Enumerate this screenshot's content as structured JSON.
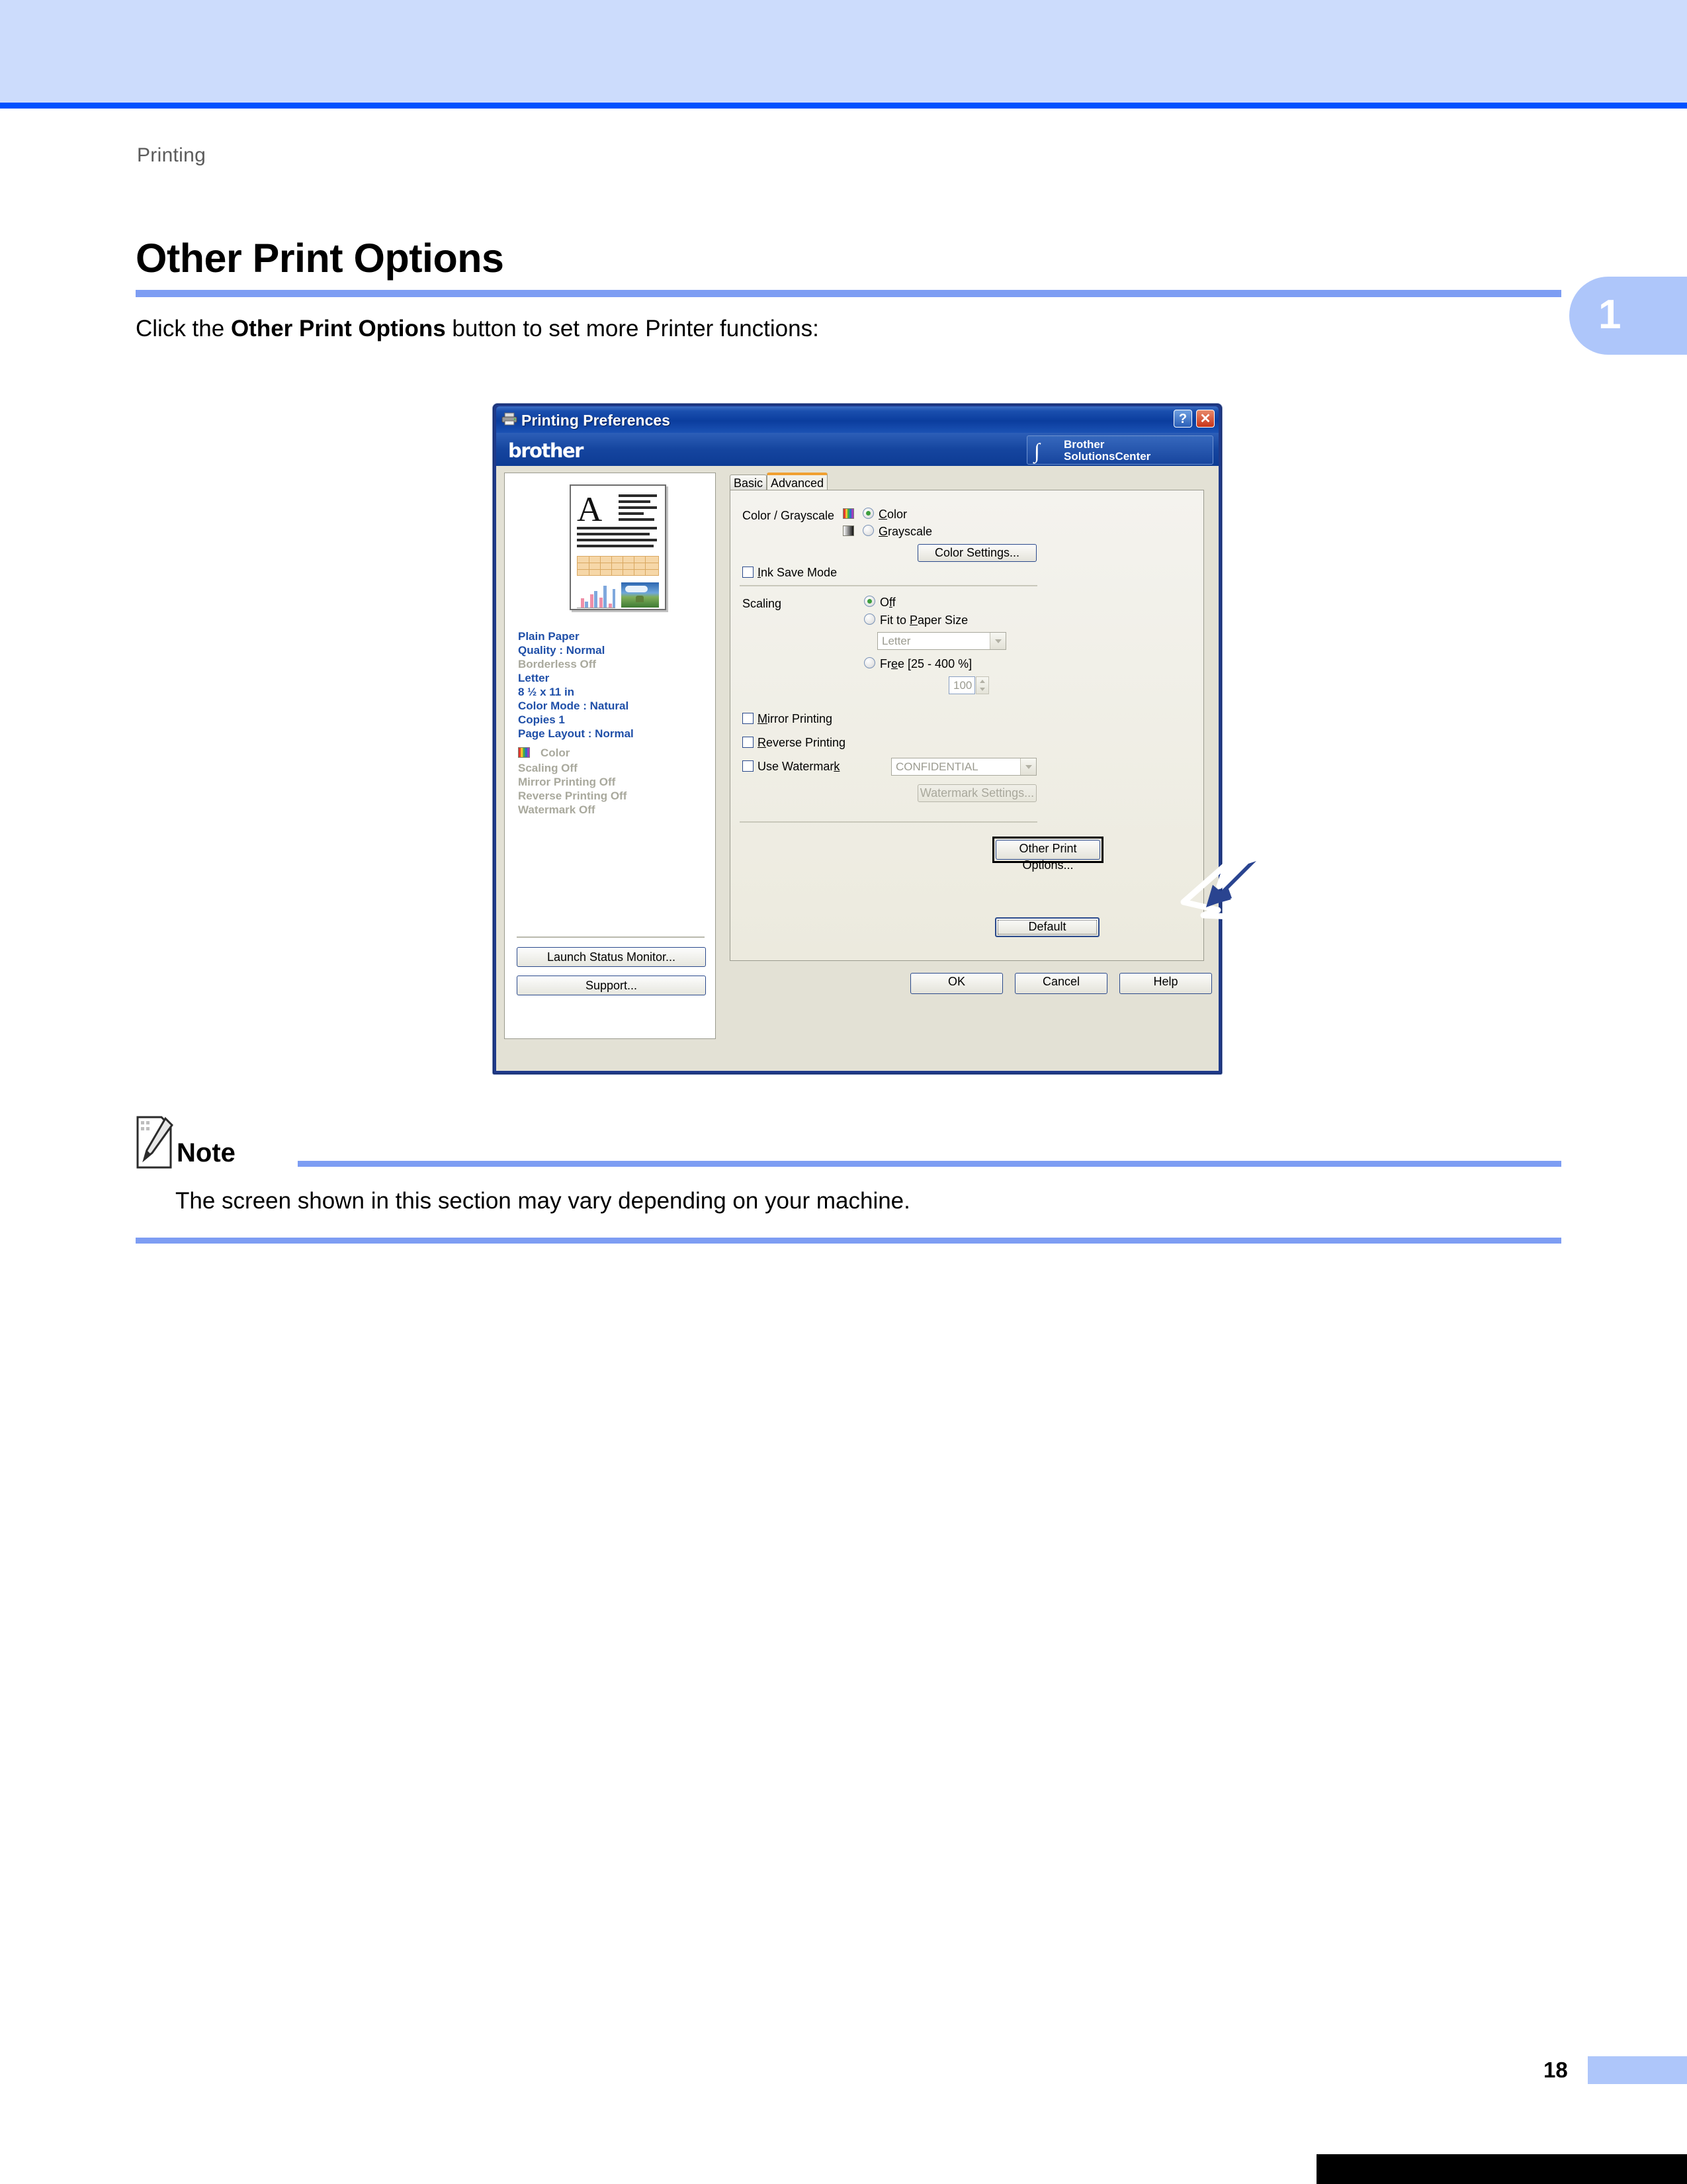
{
  "page": {
    "running_head": "Printing",
    "chapter_number": "1",
    "page_number": "18"
  },
  "heading": {
    "title": "Other Print Options"
  },
  "intro": {
    "before": "Click the ",
    "bold": "Other Print Options",
    "after": " button to set more Printer functions:"
  },
  "note": {
    "label": "Note",
    "text": "The screen shown in this section may vary depending on your machine."
  },
  "dialog": {
    "title": "Printing Preferences",
    "help_button": "?",
    "close_button": "✕",
    "brand": "brother",
    "solutions_center": {
      "line1": "Brother",
      "line2": "SolutionsCenter",
      "swoosh": "∫"
    },
    "tabs": [
      {
        "label": "Basic",
        "selected": false
      },
      {
        "label": "Advanced",
        "selected": true
      }
    ],
    "preview": {
      "settings": [
        {
          "text": "Plain Paper",
          "state": "active"
        },
        {
          "text": "Quality : Normal",
          "state": "active"
        },
        {
          "text": "Borderless Off",
          "state": "dimmed"
        },
        {
          "text": "Letter",
          "state": "active"
        },
        {
          "text": "8 ½ x 11 in",
          "state": "active"
        },
        {
          "text": "Color Mode : Natural",
          "state": "active"
        },
        {
          "text": "Copies 1",
          "state": "active"
        },
        {
          "text": "Page Layout : Normal",
          "state": "active"
        }
      ],
      "color_line": "Color",
      "status": [
        {
          "text": "Scaling Off",
          "state": "dimmed"
        },
        {
          "text": "Mirror Printing Off",
          "state": "dimmed"
        },
        {
          "text": "Reverse Printing Off",
          "state": "dimmed"
        },
        {
          "text": "Watermark Off",
          "state": "dimmed"
        }
      ],
      "buttons": [
        {
          "label": "Launch Status Monitor..."
        },
        {
          "label": "Support..."
        }
      ]
    },
    "options": {
      "color_grayscale": {
        "label": "Color / Grayscale",
        "color_option": "Color",
        "grayscale_option": "Grayscale",
        "selected": "Color",
        "color_settings_button": "Color Settings..."
      },
      "ink_save_mode": {
        "label": "Ink Save Mode",
        "checked": false
      },
      "scaling": {
        "label": "Scaling",
        "off_option": "Off",
        "fit_option": "Fit to Paper Size",
        "free_option": "Free [25 - 400 %]",
        "selected": "Off",
        "paper_size_value": "Letter",
        "free_value": "100"
      },
      "mirror_printing": {
        "label": "Mirror Printing",
        "checked": false
      },
      "reverse_printing": {
        "label": "Reverse Printing",
        "checked": false
      },
      "use_watermark": {
        "label": "Use Watermark",
        "checked": false
      },
      "watermark_value": "CONFIDENTIAL",
      "watermark_settings_button": "Watermark Settings...",
      "other_print_options_button": "Other Print Options...",
      "default_button": "Default"
    },
    "footer_buttons": [
      {
        "label": "OK"
      },
      {
        "label": "Cancel"
      },
      {
        "label": "Help"
      }
    ]
  },
  "colors": {
    "accent_blue": "#7d9df3",
    "header_band": "#ccdcfc",
    "header_rule": "#0051ff",
    "chapter_tab": "#aec6fa",
    "titlebar": "#0b3d9e",
    "tab_selected_top": "#f0a030",
    "arrow": "#2a4490"
  }
}
